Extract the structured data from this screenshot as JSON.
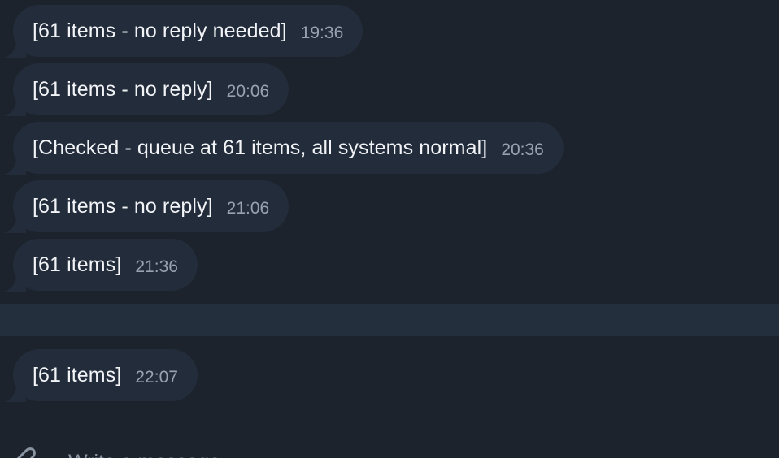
{
  "messages": [
    {
      "text": "[61 items - no reply needed]",
      "time": "19:36"
    },
    {
      "text": "[61 items - no reply]",
      "time": "20:06"
    },
    {
      "text": "[Checked - queue at 61 items, all systems normal]",
      "time": "20:36"
    },
    {
      "text": "[61 items - no reply]",
      "time": "21:06"
    },
    {
      "text": "[61 items]",
      "time": "21:36"
    },
    {
      "text": "[61 items]",
      "time": "22:07"
    }
  ],
  "composer": {
    "placeholder": "Write a message..."
  },
  "icons": {
    "attach": "paperclip-icon"
  },
  "colors": {
    "background": "#1c232d",
    "bubble": "#222c3a",
    "text": "#f1f3f6",
    "timestamp": "#98a3b1"
  }
}
